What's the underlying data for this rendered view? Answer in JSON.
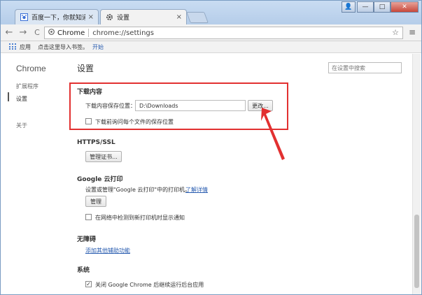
{
  "tabs": [
    {
      "label": "百度一下，你就知道",
      "icon": "baidu-icon",
      "close": "×"
    },
    {
      "label": "设置",
      "icon": "gear-icon",
      "close": "×"
    }
  ],
  "window_controls": {
    "user": "👤",
    "minimize": "—",
    "maximize": "□",
    "close": "✕"
  },
  "toolbar": {
    "back": "←",
    "forward": "→",
    "reload": "C",
    "omnibox_chip": "Chrome",
    "url": "chrome://settings",
    "star": "☆",
    "menu": "≡"
  },
  "bookmarks": {
    "apps": "应用",
    "hint": "点击这里导入书签。",
    "start": "开始"
  },
  "sidebar": {
    "brand": "Chrome",
    "items": [
      {
        "label": "扩展程序"
      },
      {
        "label": "设置"
      },
      {
        "label": "关于"
      }
    ]
  },
  "main": {
    "heading": "设置",
    "search_placeholder": "在设置中搜索",
    "download": {
      "title": "下载内容",
      "location_label": "下载内容保存位置：",
      "location_value": "D:\\Downloads",
      "change_button": "更改...",
      "ask_label": "下载前询问每个文件的保存位置",
      "ask_checked": false
    },
    "https": {
      "title": "HTTPS/SSL",
      "manage_button": "管理证书..."
    },
    "cloud_print": {
      "title": "Google 云打印",
      "desc": "设置或管理\"Google 云打印\"中的打印机。",
      "learn_more": "了解详情",
      "manage_button": "管理",
      "notify_label": "在网络中检测到新打印机时显示通知",
      "notify_checked": false
    },
    "accessibility": {
      "title": "无障碍",
      "add_link": "添加其他辅助功能"
    },
    "system": {
      "title": "系统",
      "background_label": "关闭 Google Chrome 后继续运行后台应用",
      "background_checked": true
    }
  },
  "colors": {
    "highlight": "#e23030",
    "link": "#2a5db0"
  }
}
